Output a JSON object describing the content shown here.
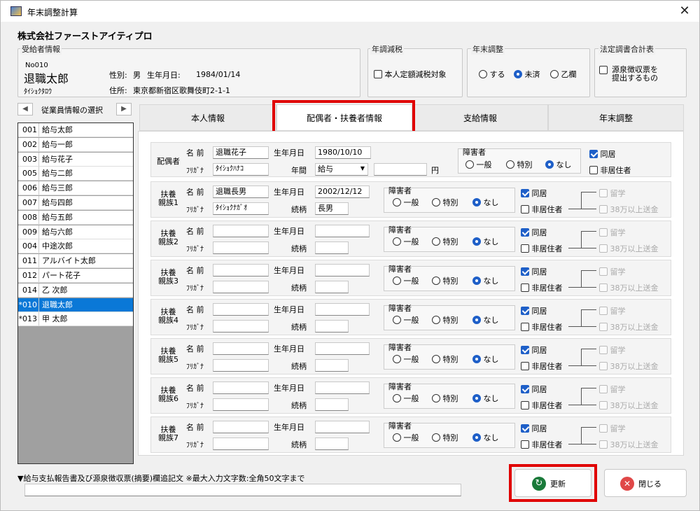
{
  "window": {
    "title": "年末調整計算",
    "company": "株式会社ファーストアイティプロ"
  },
  "recipient": {
    "group_label": "受給者情報",
    "no": "No010",
    "name": "退職太郎",
    "kana": "ﾀｲｼｮｸﾀﾛｳ",
    "sex_label": "性別:",
    "sex": "男",
    "birth_label": "生年月日:",
    "birth": "1984/01/14",
    "addr_label": "住所:",
    "address": "東京都新宿区歌舞伎町2-1-1"
  },
  "nencho_genzei": {
    "group_label": "年調減税",
    "check_label": "本人定額減税対象",
    "checked": false
  },
  "nenmatsu": {
    "group_label": "年末調整",
    "options": [
      "する",
      "未済",
      "乙欄"
    ],
    "selected": 1
  },
  "houtei": {
    "group_label": "法定調書合計表",
    "check_label_1": "源泉徴収票を",
    "check_label_2": "提出するもの",
    "checked": false
  },
  "employee_select": {
    "label": "従業員情報の選択",
    "prev": "◀",
    "next": "▶"
  },
  "employees": [
    {
      "code": "001",
      "name": "給与太郎"
    },
    {
      "code": "002",
      "name": "給与一郎"
    },
    {
      "code": "003",
      "name": "給与花子"
    },
    {
      "code": "005",
      "name": "給与二郎"
    },
    {
      "code": "006",
      "name": "給与三郎"
    },
    {
      "code": "007",
      "name": "給与四郎"
    },
    {
      "code": "008",
      "name": "給与五郎"
    },
    {
      "code": "009",
      "name": "給与六郎"
    },
    {
      "code": "004",
      "name": "中途次郎"
    },
    {
      "code": "011",
      "name": "アルバイト太郎"
    },
    {
      "code": "012",
      "name": "パート花子"
    },
    {
      "code": "014",
      "name": "乙 次郎"
    },
    {
      "code": "*010",
      "name": "退職太郎"
    },
    {
      "code": "*013",
      "name": "甲 太郎"
    }
  ],
  "selected_employee": 12,
  "tabs": [
    "本人情報",
    "配偶者・扶養者情報",
    "支給情報",
    "年末調整"
  ],
  "active_tab": 1,
  "labels": {
    "name": "名 前",
    "kana": "ﾌﾘｶﾞﾅ",
    "birth": "生年月日",
    "annual": "年間",
    "relation": "続柄",
    "yen": "円",
    "handicap": "障害者",
    "h_general": "一般",
    "h_special": "特別",
    "h_none": "なし",
    "dokyo": "同居",
    "hikyo": "非居住者",
    "ryugaku": "留学",
    "souken": "38万以上送金"
  },
  "spouse": {
    "title": "配偶者",
    "name": "退職花子",
    "kana": "ﾀｲｼｮｸﾊﾅｺ",
    "birth": "1980/10/10",
    "income_type": "給与",
    "income": "",
    "dokyo": true,
    "hikyo": false
  },
  "dependents": [
    {
      "title1": "扶養",
      "title2": "親族1",
      "name": "退職長男",
      "kana": "ﾀｲｼｮｸﾅｶﾞｵ",
      "birth": "2002/12/12",
      "relation": "長男"
    },
    {
      "title1": "扶養",
      "title2": "親族2",
      "name": "",
      "kana": "",
      "birth": "",
      "relation": ""
    },
    {
      "title1": "扶養",
      "title2": "親族3",
      "name": "",
      "kana": "",
      "birth": "",
      "relation": ""
    },
    {
      "title1": "扶養",
      "title2": "親族4",
      "name": "",
      "kana": "",
      "birth": "",
      "relation": ""
    },
    {
      "title1": "扶養",
      "title2": "親族5",
      "name": "",
      "kana": "",
      "birth": "",
      "relation": ""
    },
    {
      "title1": "扶養",
      "title2": "親族6",
      "name": "",
      "kana": "",
      "birth": "",
      "relation": ""
    },
    {
      "title1": "扶養",
      "title2": "親族7",
      "name": "",
      "kana": "",
      "birth": "",
      "relation": ""
    }
  ],
  "footer": {
    "note": "▼給与支払報告書及び源泉徴収票(摘要)欄追記文 ※最大入力文字数:全角50文字まで",
    "note_value": "",
    "update": "更新",
    "close": "閉じる"
  },
  "colors": {
    "accent": "#1e5fc8",
    "selection": "#0a78d7",
    "highlight": "#e00000",
    "update_icon": "#1a7a3a",
    "close_icon": "#e04848"
  }
}
